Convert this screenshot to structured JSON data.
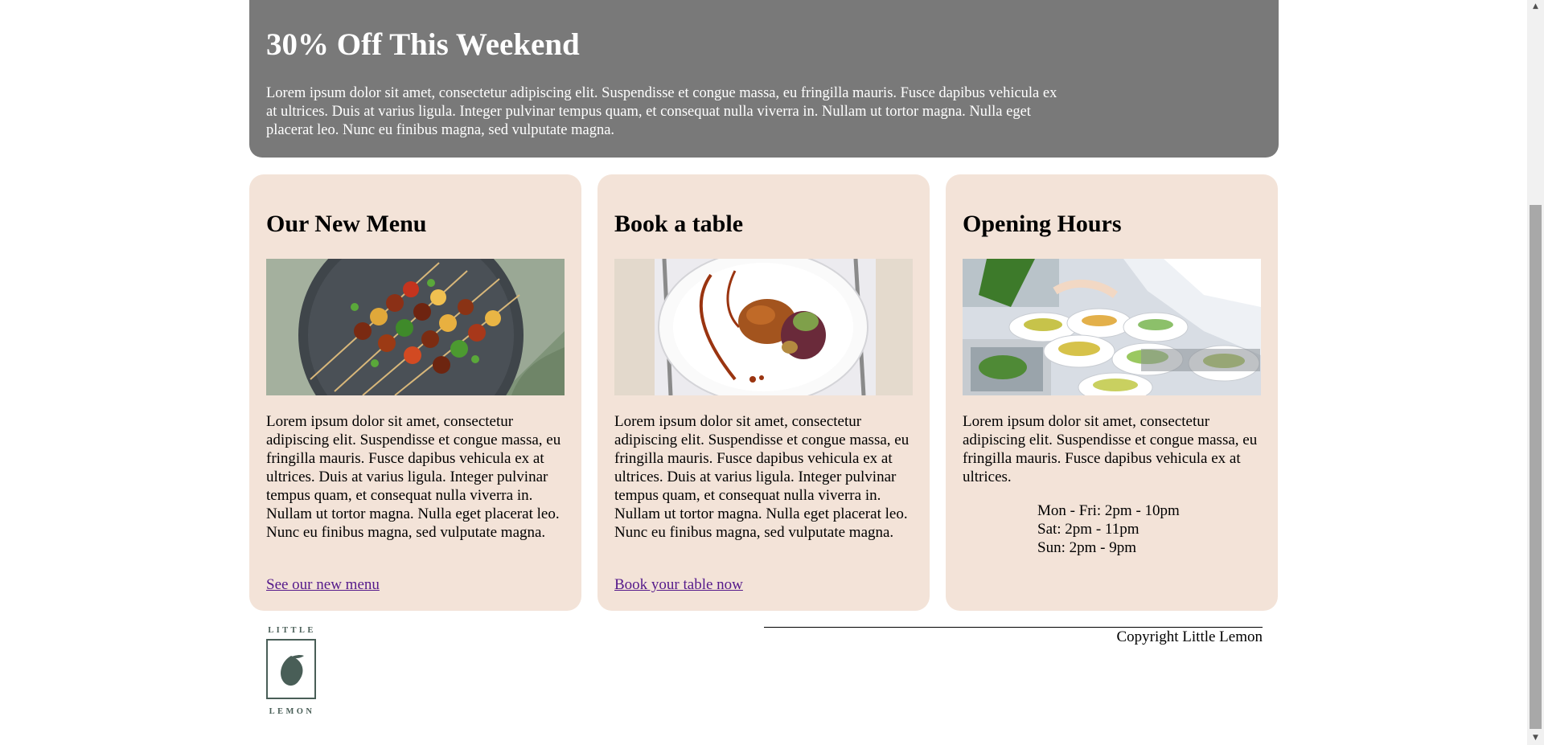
{
  "promo": {
    "title": "30% Off This Weekend",
    "text": "Lorem ipsum dolor sit amet, consectetur adipiscing elit. Suspendisse et congue massa, eu fringilla mauris. Fusce dapibus vehicula ex at ultrices. Duis at varius ligula. Integer pulvinar tempus quam, et consequat nulla viverra in. Nullam ut tortor magna. Nulla eget placerat leo. Nunc eu finibus magna, sed vulputate magna."
  },
  "cards": [
    {
      "title": "Our New Menu",
      "image": "grilled-skewers-image",
      "text": "Lorem ipsum dolor sit amet, consectetur adipiscing elit. Suspendisse et congue massa, eu fringilla mauris. Fusce dapibus vehicula ex at ultrices. Duis at varius ligula. Integer pulvinar tempus quam, et consequat nulla viverra in. Nullam ut tortor magna. Nulla eget placerat leo. Nunc eu finibus magna, sed vulputate magna.",
      "link": "See our new menu"
    },
    {
      "title": "Book a table",
      "image": "plated-dish-image",
      "text": "Lorem ipsum dolor sit amet, consectetur adipiscing elit. Suspendisse et congue massa, eu fringilla mauris. Fusce dapibus vehicula ex at ultrices. Duis at varius ligula. Integer pulvinar tempus quam, et consequat nulla viverra in. Nullam ut tortor magna. Nulla eget placerat leo. Nunc eu finibus magna, sed vulputate magna.",
      "link": "Book your table now"
    },
    {
      "title": "Opening Hours",
      "image": "chef-plating-image",
      "text": "Lorem ipsum dolor sit amet, consectetur adipiscing elit. Suspendisse et congue massa, eu fringilla mauris. Fusce dapibus vehicula ex at ultrices.",
      "hours": [
        "Mon - Fri: 2pm - 10pm",
        "Sat: 2pm - 11pm",
        "Sun: 2pm - 9pm"
      ]
    }
  ],
  "footer": {
    "logo_top": "LITTLE",
    "logo_bottom": "LEMON",
    "copyright": "Copyright Little Lemon"
  },
  "colors": {
    "promo_bg": "#797979",
    "card_bg": "#f3e3d8",
    "link": "#551a8b",
    "logo": "#495e57"
  }
}
